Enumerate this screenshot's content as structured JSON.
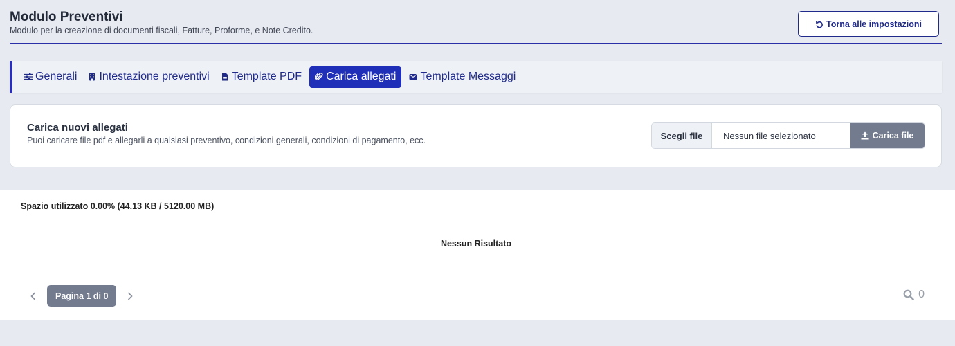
{
  "header": {
    "title": "Modulo Preventivi",
    "subtitle": "Modulo per la creazione di documenti fiscali, Fatture, Proforme, e Note Credito.",
    "back_label": "Torna alle impostazioni"
  },
  "tabs": [
    {
      "label": "Generali",
      "icon": "sliders-icon"
    },
    {
      "label": "Intestazione preventivi",
      "icon": "building-icon"
    },
    {
      "label": "Template PDF",
      "icon": "pdf-file-icon"
    },
    {
      "label": "Carica allegati",
      "icon": "paperclip-icon",
      "active": true
    },
    {
      "label": "Template Messaggi",
      "icon": "envelope-icon"
    }
  ],
  "upload": {
    "title": "Carica nuovi allegati",
    "description": "Puoi caricare file pdf e allegarli a qualsiasi preventivo, condizioni generali, condizioni di pagamento, ecc.",
    "choose_label": "Scegli file",
    "file_status": "Nessun file selezionato",
    "upload_label": "Carica file"
  },
  "list": {
    "space_used": "Spazio utilizzato 0.00% (44.13 KB / 5120.00 MB)",
    "empty_message": "Nessun Risultato",
    "page_label": "Pagina 1 di 0",
    "result_count": "0"
  },
  "colors": {
    "accent": "#1f2fb8",
    "accent_dark": "#1f2a8a",
    "muted_button": "#737b8f",
    "background": "#e7eaf0"
  }
}
